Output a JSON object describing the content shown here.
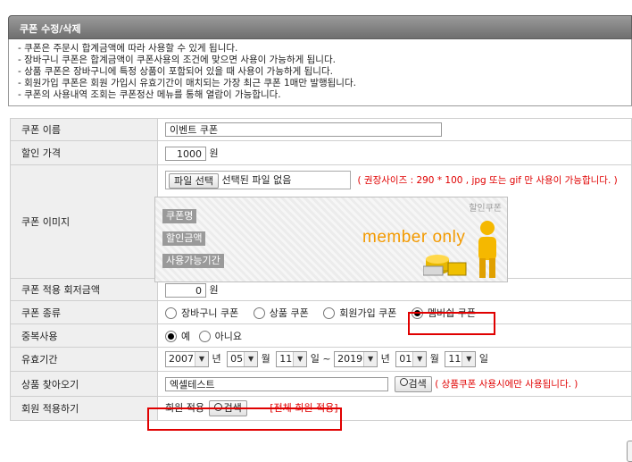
{
  "header": {
    "title": "쿠폰 수정/삭제"
  },
  "notice": [
    "- 쿠폰은 주문시 합계금액에 따라 사용할 수 있게 됩니다.",
    "- 장바구니 쿠폰은 합계금액이 쿠폰사용의 조건에 맞으면 사용이 가능하게 됩니다.",
    "- 상품 쿠폰은 장바구니에 특정 상품이 포함되어 있을 때 사용이 가능하게 됩니다.",
    "- 회원가입 쿠폰은 회원 가입시 유효기간이 매치되는 가장 최근 쿠폰 1매만 발행됩니다.",
    "- 쿠폰의 사용내역 조회는 쿠폰정산 메뉴를 통해 열람이 가능합니다."
  ],
  "form": {
    "name": {
      "label": "쿠폰 이름",
      "value": "이벤트 쿠폰"
    },
    "price": {
      "label": "할인 가격",
      "value": "1000",
      "unit": "원"
    },
    "image": {
      "label": "쿠폰 이미지",
      "file_button": "파일 선택",
      "file_status": "선택된 파일 없음",
      "hint": "( 권장사이즈 : 290 * 100 , jpg 또는 gif 만 사용이 가능합니다. )",
      "preview": {
        "corner": "할인쿠폰",
        "tag_name": "쿠폰명",
        "tag_amount": "할인금액",
        "tag_period": "사용가능기간",
        "logo": "member only"
      }
    },
    "min_amount": {
      "label": "쿠폰 적용 회저금액",
      "value": "0",
      "unit": "원"
    },
    "type": {
      "label": "쿠폰 종류",
      "options": [
        "장바구니 쿠폰",
        "상품 쿠폰",
        "회원가입 쿠폰",
        "멤버쉽 쿠폰"
      ],
      "selected": "멤버쉽 쿠폰"
    },
    "duplicate": {
      "label": "중복사용",
      "options": [
        "예",
        "아니요"
      ],
      "selected": "예"
    },
    "period": {
      "label": "유효기간",
      "start": {
        "year": "2007",
        "month": "05",
        "day": "11"
      },
      "end": {
        "year": "2019",
        "month": "01",
        "day": "11"
      },
      "unit_year": "년",
      "unit_month": "월",
      "unit_day": "일",
      "tilde": "~"
    },
    "product": {
      "label": "상품 찾아오기",
      "value": "엑셀테스트",
      "search": "검색",
      "hint": "( 상품쿠폰 사용시에만 사용됩니다. )"
    },
    "member": {
      "label": "회원 적용하기",
      "prefix": "회원 적용",
      "search": "검색",
      "note": "[전체 회원 적용]"
    }
  },
  "colors": {
    "header_bg": "#7f7f7f",
    "label_bg": "#efefef",
    "highlight": "#e00000",
    "logo_orange": "#f39a00",
    "figure_yellow": "#f5b800"
  }
}
